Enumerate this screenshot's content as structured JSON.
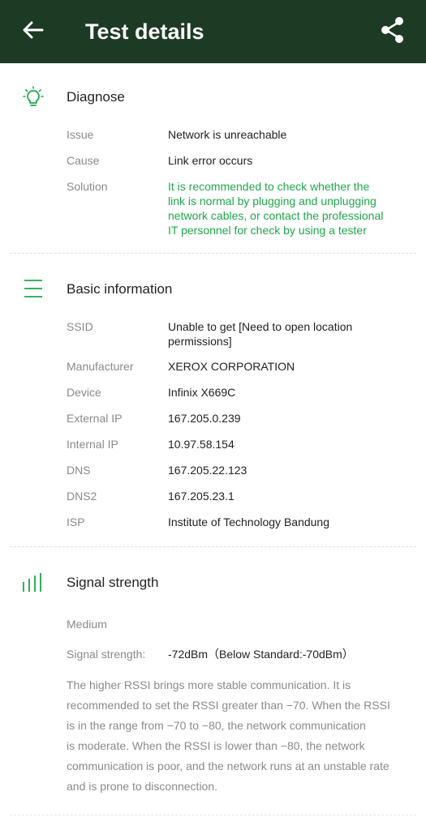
{
  "header": {
    "title": "Test details",
    "back_icon": "arrow-left-icon",
    "share_icon": "share-icon"
  },
  "colors": {
    "appbar": "#1c3a24",
    "accent_green": "#1fa64a"
  },
  "diagnose": {
    "title": "Diagnose",
    "icon": "lightbulb-icon",
    "issue_label": "Issue",
    "issue_value": "Network is unreachable",
    "cause_label": "Cause",
    "cause_value": "Link error occurs",
    "solution_label": "Solution",
    "solution_lines": [
      "It is recommended to check whether the",
      "link is normal by plugging and unplugging",
      "network cables, or contact the professional",
      "IT personnel for check by using a tester"
    ]
  },
  "basic_info": {
    "title": "Basic information",
    "icon": "menu-lines-icon",
    "ssid_label": "SSID",
    "ssid_value": "Unable to get [Need to open location permissions]",
    "manufacturer_label": "Manufacturer",
    "manufacturer_value": "XEROX CORPORATION",
    "device_label": "Device",
    "device_value": "Infinix X669C",
    "external_ip_label": "External IP",
    "external_ip_value": "167.205.0.239",
    "internal_ip_label": "Internal IP",
    "internal_ip_value": "10.97.58.154",
    "dns_label": "DNS",
    "dns_value": "167.205.22.123",
    "dns2_label": "DNS2",
    "dns2_value": "167.205.23.1",
    "isp_label": "ISP",
    "isp_value": "Institute of Technology Bandung"
  },
  "signal": {
    "title": "Signal strength",
    "icon": "signal-bars-icon",
    "level": "Medium",
    "strength_label": "Signal strength:",
    "strength_value": "-72dBm（Below Standard:-70dBm）",
    "explanation_lines": [
      "The higher RSSI brings more stable communication. It is",
      "recommended to set the RSSI greater than −70. When the RSSI",
      "is in the range from −70 to −80, the network communication",
      "is moderate. When the RSSI is lower than −80, the network",
      "communication is poor, and the network runs at an unstable rate",
      "and is prone to disconnection."
    ]
  }
}
